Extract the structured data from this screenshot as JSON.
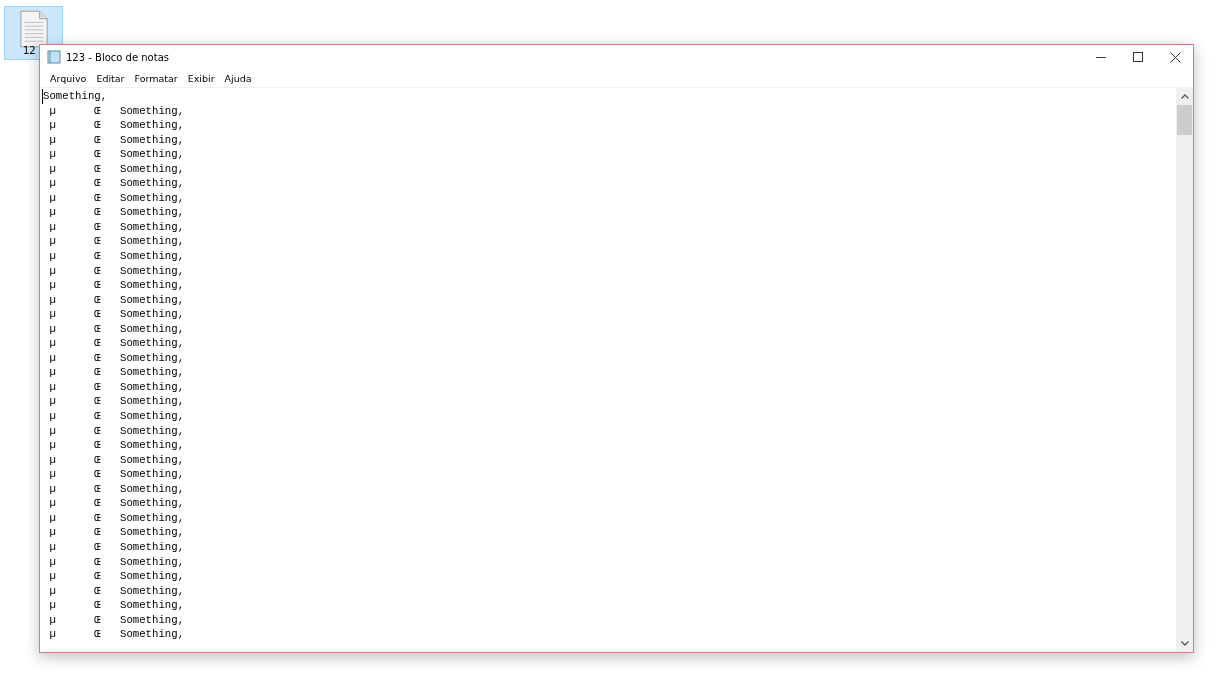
{
  "desktop_icon": {
    "label": "12",
    "selected": true
  },
  "window": {
    "title": "123 - Bloco de notas"
  },
  "menu": [
    "Arquivo",
    "Editar",
    "Formatar",
    "Exibir",
    "Ajuda"
  ],
  "editor": {
    "lines": [
      "Something,",
      " µ      Œ   Something,",
      " µ      Œ   Something,",
      " µ      Œ   Something,",
      " µ      Œ   Something,",
      " µ      Œ   Something,",
      " µ      Œ   Something,",
      " µ      Œ   Something,",
      " µ      Œ   Something,",
      " µ      Œ   Something,",
      " µ      Œ   Something,",
      " µ      Œ   Something,",
      " µ      Œ   Something,",
      " µ      Œ   Something,",
      " µ      Œ   Something,",
      " µ      Œ   Something,",
      " µ      Œ   Something,",
      " µ      Œ   Something,",
      " µ      Œ   Something,",
      " µ      Œ   Something,",
      " µ      Œ   Something,",
      " µ      Œ   Something,",
      " µ      Œ   Something,",
      " µ      Œ   Something,",
      " µ      Œ   Something,",
      " µ      Œ   Something,",
      " µ      Œ   Something,",
      " µ      Œ   Something,",
      " µ      Œ   Something,",
      " µ      Œ   Something,",
      " µ      Œ   Something,",
      " µ      Œ   Something,",
      " µ      Œ   Something,",
      " µ      Œ   Something,",
      " µ      Œ   Something,",
      " µ      Œ   Something,",
      " µ      Œ   Something,",
      " µ      Œ   Something,"
    ]
  }
}
